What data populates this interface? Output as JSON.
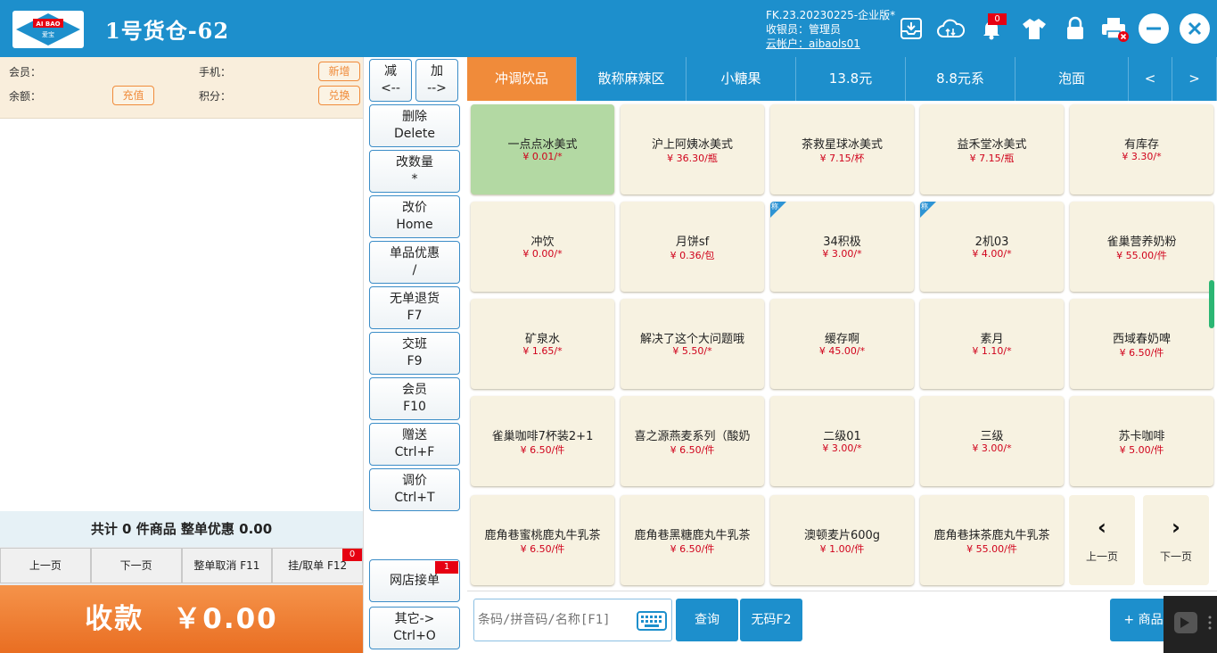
{
  "header": {
    "logo_text_top": "AI BAO",
    "logo_text_bottom": "爱宝",
    "title": "1号货仓-62",
    "version": "FK.23.20230225-企业版*",
    "cashier": "收银员：管理员",
    "account": "云帐户：aibaols01",
    "notification_count": "0"
  },
  "member": {
    "member_label": "会员：",
    "phone_label": "手机：",
    "balance_label": "余额：",
    "points_label": "积分：",
    "add_btn": "新增",
    "recharge_btn": "充值",
    "redeem_btn": "兑换"
  },
  "summary": {
    "total": "共计 0 件商品 整单优惠 0.00"
  },
  "pager": {
    "prev": "上一页",
    "next": "下一页",
    "cancel_all": "整单取消 F11",
    "hold": "挂/取单 F12",
    "hold_count": "0"
  },
  "pay": {
    "label": "收款　￥0.00"
  },
  "functions": {
    "minus": [
      "减",
      "<--"
    ],
    "plus": [
      "加",
      "-->"
    ],
    "buttons": [
      [
        "删除",
        "Delete"
      ],
      [
        "改数量",
        "*"
      ],
      [
        "改价",
        "Home"
      ],
      [
        "单品优惠",
        "/"
      ],
      [
        "无单退货",
        "F7"
      ],
      [
        "交班",
        "F9"
      ],
      [
        "会员",
        "F10"
      ],
      [
        "赠送",
        "Ctrl+F"
      ],
      [
        "调价",
        "Ctrl+T"
      ]
    ],
    "online_orders": "网店接单",
    "online_count": "1",
    "other": [
      "其它->",
      "Ctrl+O"
    ]
  },
  "tabs": [
    "冲调饮品",
    "散称麻辣区",
    "小糖果",
    "13.8元",
    "8.8元系",
    "泡面",
    "<",
    ">"
  ],
  "products": [
    {
      "name": "一点点冰美式",
      "price": "¥ 0.01/*"
    },
    {
      "name": "沪上阿姨冰美式",
      "price": "¥ 36.30/瓶"
    },
    {
      "name": "茶救星球冰美式",
      "price": "¥ 7.15/杯"
    },
    {
      "name": "益禾堂冰美式",
      "price": "¥ 7.15/瓶"
    },
    {
      "name": "有库存",
      "price": "¥ 3.30/*"
    },
    {
      "name": "冲饮",
      "price": "¥ 0.00/*"
    },
    {
      "name": "月饼sf",
      "price": "¥ 0.36/包"
    },
    {
      "name": "34积极",
      "price": "¥ 3.00/*",
      "tag": "称"
    },
    {
      "name": "2机03",
      "price": "¥ 4.00/*",
      "tag": "称"
    },
    {
      "name": "雀巢营养奶粉",
      "price": "¥ 55.00/件"
    },
    {
      "name": "矿泉水",
      "price": "¥ 1.65/*"
    },
    {
      "name": "解决了这个大问题哦",
      "price": "¥ 5.50/*"
    },
    {
      "name": "缓存啊",
      "price": "¥ 45.00/*"
    },
    {
      "name": "素月",
      "price": "¥ 1.10/*"
    },
    {
      "name": "西域春奶啤",
      "price": "¥ 6.50/件"
    },
    {
      "name": "雀巢咖啡7杯装2+1",
      "price": "¥ 6.50/件"
    },
    {
      "name": "喜之源燕麦系列（酸奶",
      "price": "¥ 6.50/件"
    },
    {
      "name": "二级01",
      "price": "¥ 3.00/*"
    },
    {
      "name": "三级",
      "price": "¥ 3.00/*"
    },
    {
      "name": "苏卡咖啡",
      "price": "¥ 5.00/件"
    },
    {
      "name": "鹿角巷蜜桃鹿丸牛乳茶",
      "price": "¥ 6.50/件"
    },
    {
      "name": "鹿角巷黑糖鹿丸牛乳茶",
      "price": "¥ 6.50/件"
    },
    {
      "name": "澳顿麦片600g",
      "price": "¥ 1.00/件"
    },
    {
      "name": "鹿角巷抹茶鹿丸牛乳茶",
      "price": "¥ 55.00/件"
    }
  ],
  "grid_nav": {
    "prev": "上一页",
    "next": "下一页"
  },
  "bottom": {
    "search_placeholder": "条码/拼音码/名称[F1]",
    "query": "查询",
    "no_code": "无码F2",
    "add_product": "+ 商品"
  }
}
